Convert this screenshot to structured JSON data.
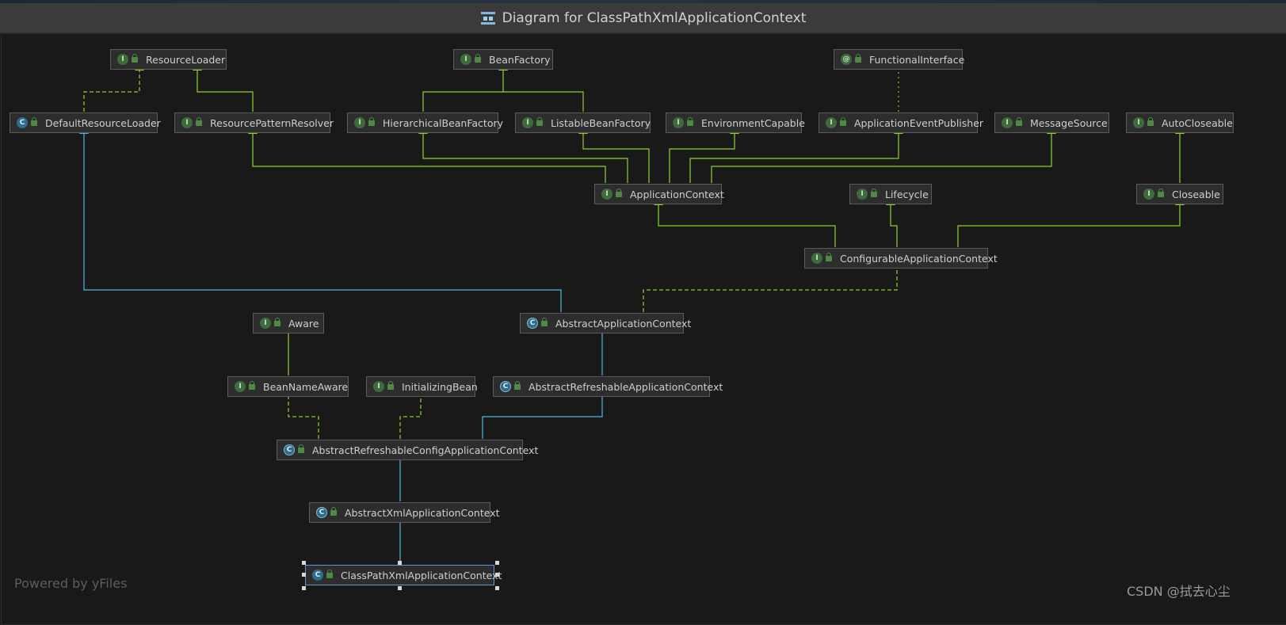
{
  "window": {
    "title": "Diagram for ClassPathXmlApplicationContext"
  },
  "footer": {
    "powered_by": "Powered by yFiles",
    "watermark": "CSDN @拭去心尘"
  },
  "legend": {
    "interface_kind": "I",
    "class_kind": "C",
    "annotation_kind": "@"
  },
  "nodes": {
    "resource_loader": "ResourceLoader",
    "bean_factory": "BeanFactory",
    "functional_interface": "FunctionalInterface",
    "default_resource_loader": "DefaultResourceLoader",
    "resource_pattern_resolver": "ResourcePatternResolver",
    "hierarchical_bean_factory": "HierarchicalBeanFactory",
    "listable_bean_factory": "ListableBeanFactory",
    "environment_capable": "EnvironmentCapable",
    "application_event_publisher": "ApplicationEventPublisher",
    "message_source": "MessageSource",
    "auto_closeable": "AutoCloseable",
    "application_context": "ApplicationContext",
    "lifecycle": "Lifecycle",
    "closeable": "Closeable",
    "configurable_application_context": "ConfigurableApplicationContext",
    "aware": "Aware",
    "abstract_application_context": "AbstractApplicationContext",
    "bean_name_aware": "BeanNameAware",
    "initializing_bean": "InitializingBean",
    "abstract_refreshable_application_context": "AbstractRefreshableApplicationContext",
    "abstract_refreshable_config_application_context": "AbstractRefreshableConfigApplicationContext",
    "abstract_xml_application_context": "AbstractXmlApplicationContext",
    "class_path_xml_application_context": "ClassPathXmlApplicationContext"
  },
  "colors": {
    "interface_edge": "#8fd12a",
    "class_edge": "#4fb8dd",
    "functional_edge": "#c9a227",
    "selected_border": "#5b9ad9"
  }
}
